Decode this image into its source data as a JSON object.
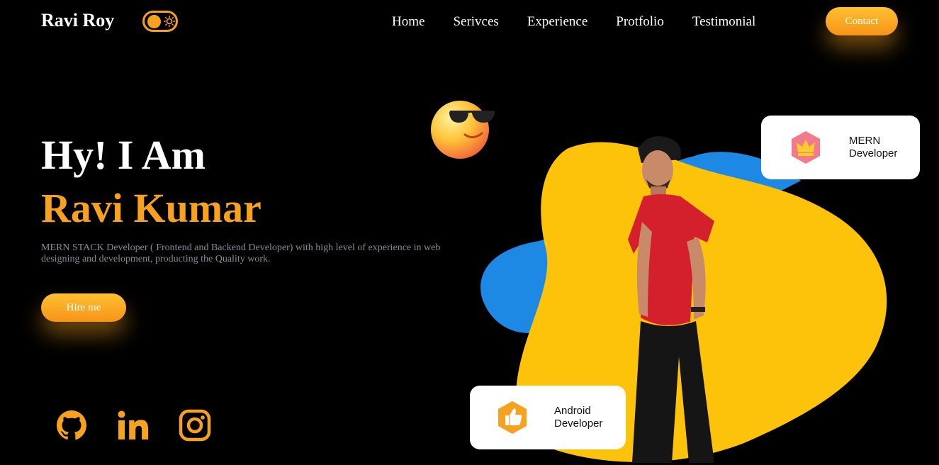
{
  "nav": {
    "brand": "Ravi Roy",
    "links": [
      "Home",
      "Serivces",
      "Experience",
      "Protfolio",
      "Testimonial"
    ],
    "contact_label": "Contact"
  },
  "hero": {
    "greeting": "Hy! I Am",
    "name": "Ravi Kumar",
    "description": "MERN STACK Developer ( Frontend and Backend Developer) with high level of experience in web designing and development, producting the Quality work.",
    "hire_label": "Hire me"
  },
  "cards": {
    "mern": {
      "line1": "MERN",
      "line2": "Developer"
    },
    "android": {
      "line1": "Android",
      "line2": "Developer"
    }
  },
  "social": [
    "github-icon",
    "linkedin-icon",
    "instagram-icon"
  ],
  "colors": {
    "accent": "#f7a21f",
    "yellow": "#fdc20a",
    "blue": "#1e88e5",
    "background": "#000000"
  }
}
